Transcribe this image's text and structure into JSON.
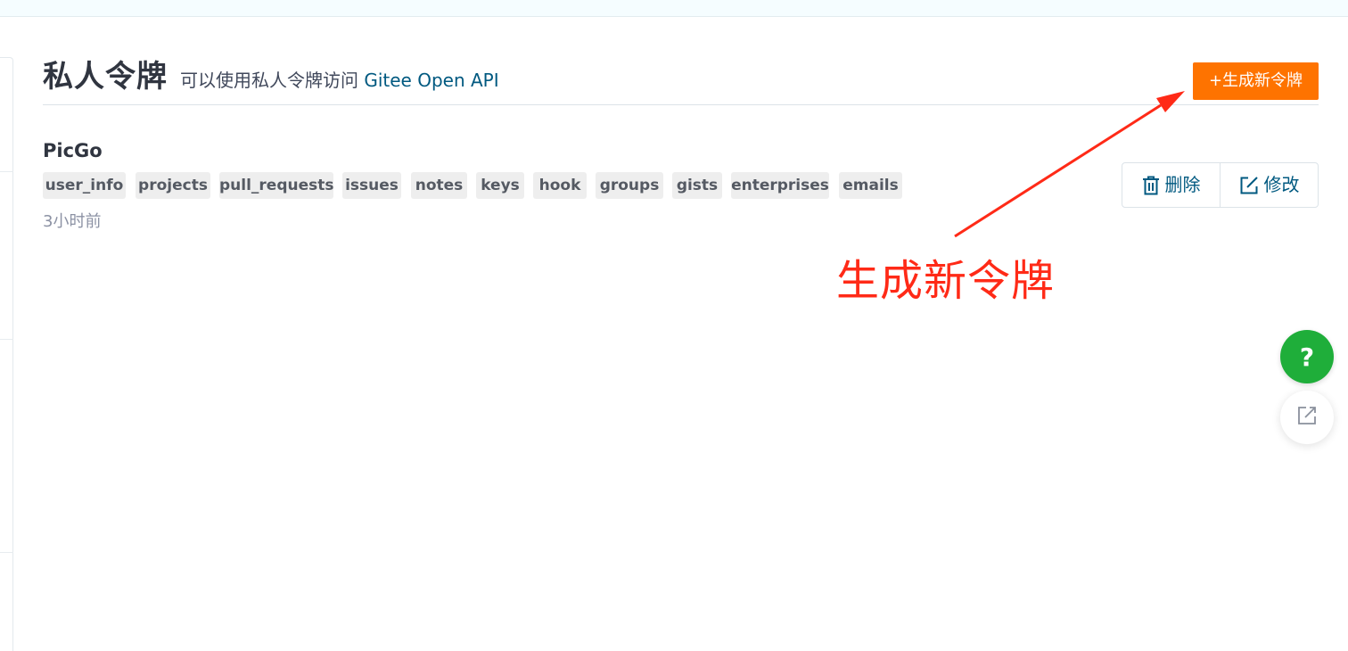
{
  "header": {
    "title": "私人令牌",
    "subtitle_prefix": "可以使用私人令牌访问 ",
    "subtitle_link": "Gitee Open API",
    "new_token_button": "+生成新令牌"
  },
  "token": {
    "name": "PicGo",
    "scopes": [
      "user_info",
      "projects",
      "pull_requests",
      "issues",
      "notes",
      "keys",
      "hook",
      "groups",
      "gists",
      "enterprises",
      "emails"
    ],
    "created": "3小时前",
    "actions": {
      "delete": "删除",
      "edit": "修改"
    }
  },
  "annotation": {
    "text": "生成新令牌",
    "color": "#ff2a17"
  },
  "floating": {
    "help_label": "?"
  },
  "colors": {
    "accent": "#fe7300",
    "link": "#005980",
    "help": "#1fae3a"
  },
  "icons": [
    "trash-icon",
    "edit-icon",
    "external-link-icon"
  ]
}
